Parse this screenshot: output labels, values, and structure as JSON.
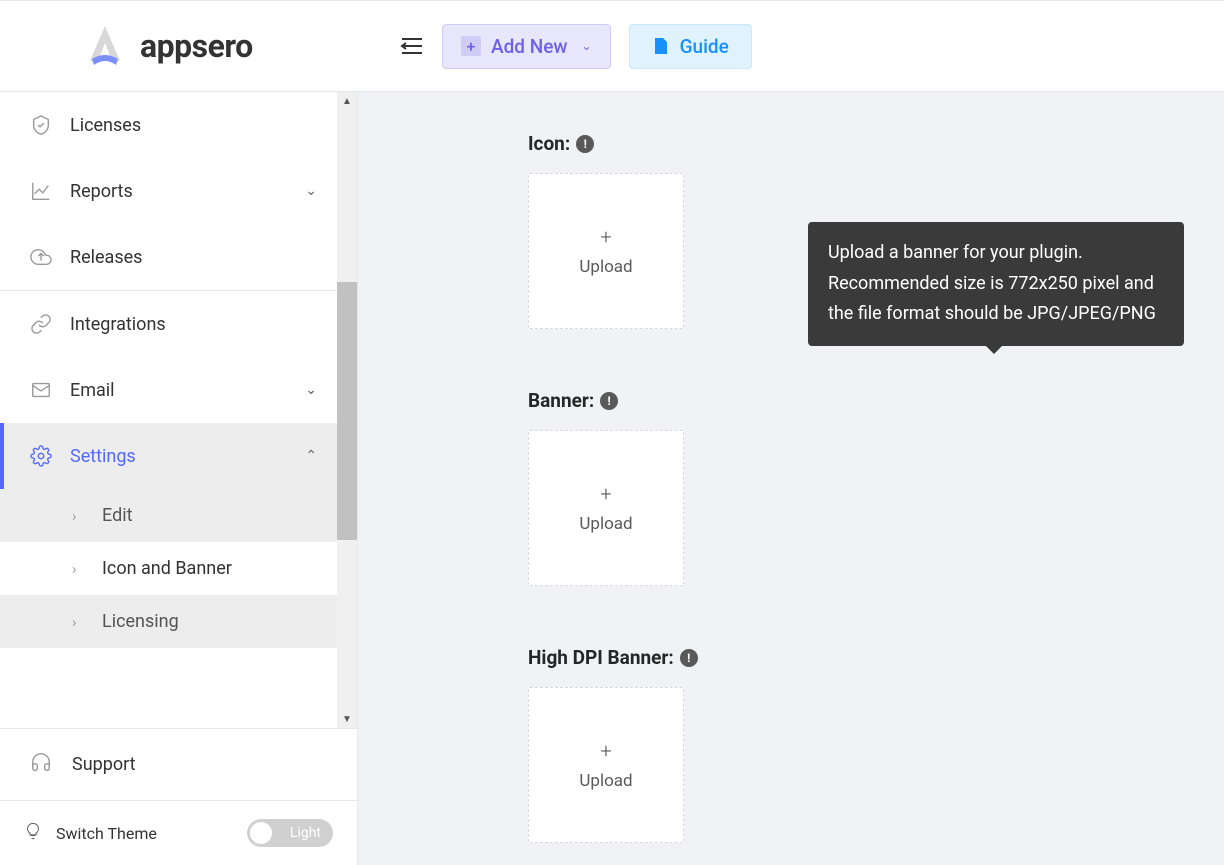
{
  "header": {
    "logo_text": "appsero",
    "add_new_label": "Add New",
    "guide_label": "Guide"
  },
  "sidebar": {
    "items": [
      {
        "label": "Licenses"
      },
      {
        "label": "Reports"
      },
      {
        "label": "Releases"
      },
      {
        "label": "Integrations"
      },
      {
        "label": "Email"
      },
      {
        "label": "Settings"
      }
    ],
    "sub_items": [
      {
        "label": "Edit"
      },
      {
        "label": "Icon and Banner"
      },
      {
        "label": "Licensing"
      }
    ],
    "support_label": "Support",
    "theme_label": "Switch Theme",
    "theme_mode": "Light"
  },
  "main": {
    "icon_label": "Icon:",
    "banner_label": "Banner:",
    "highdpi_label": "High DPI Banner:",
    "upload_text": "Upload",
    "tooltip_text": "Upload a banner for your plugin. Recommended size is 772x250 pixel and the file format should be JPG/JPEG/PNG"
  }
}
